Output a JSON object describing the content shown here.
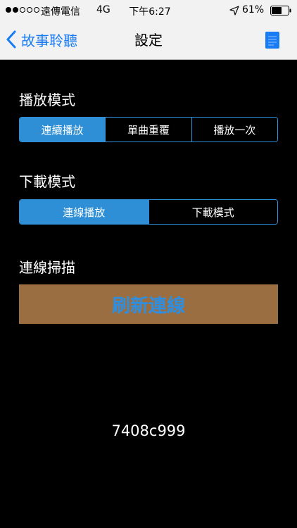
{
  "status_bar": {
    "signal_dots": 5,
    "signal_strength": 2,
    "carrier": "遠傳電信",
    "network": "4G",
    "time": "下午6:27",
    "location_icon": "location-arrow-icon",
    "battery_percent": "61%",
    "battery_level": 0.61
  },
  "nav": {
    "back_label": "故事聆聽",
    "title": "設定",
    "back_icon": "chevron-left-icon",
    "document_icon": "document-icon"
  },
  "playback_mode": {
    "label": "播放模式",
    "options": [
      "連續播放",
      "單曲重覆",
      "播放一次"
    ],
    "selected_index": 0
  },
  "download_mode": {
    "label": "下載模式",
    "options": [
      "連線播放",
      "下載模式"
    ],
    "selected_index": 0
  },
  "connection_scan": {
    "label": "連線掃描",
    "refresh_label": "刷新連線"
  },
  "device_id": "7408c999",
  "colors": {
    "accent": "#2e8fd6",
    "nav_blue": "#1a7cf5",
    "refresh_bg": "#9b6e42",
    "refresh_text": "#2e8fe0",
    "background": "#000000",
    "nav_bg": "#f2f2f2"
  }
}
